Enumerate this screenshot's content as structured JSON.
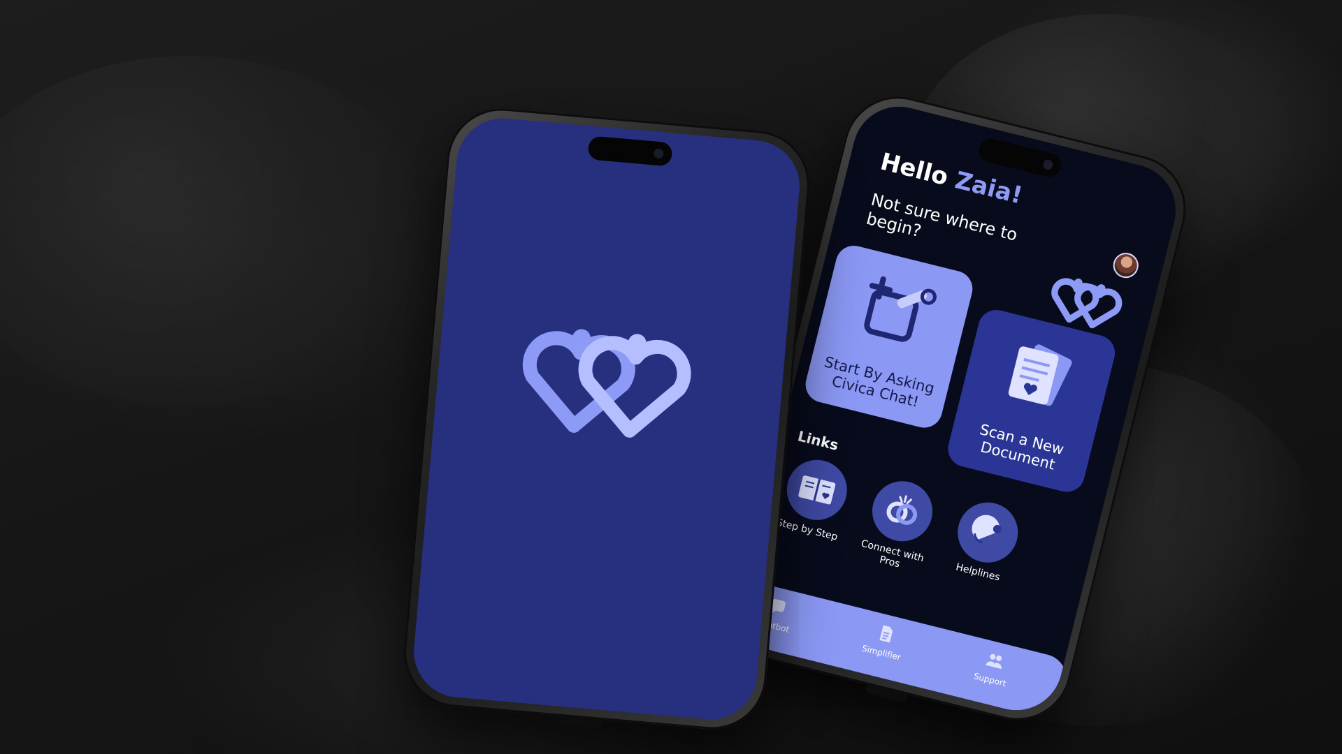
{
  "splash": {
    "logo_icon": "linked-hearts-logo",
    "background": "#26307f",
    "logo_color": "#8e9bf6"
  },
  "home": {
    "greeting_prefix": "Hello",
    "greeting_name": "Zaia!",
    "prompt": "Not sure where to begin?",
    "accent": "#8b98f4",
    "cards": [
      {
        "label": "Start By Asking Civica Chat!",
        "icon": "chat-edit-icon"
      },
      {
        "label": "Scan a New Document",
        "icon": "document-icon"
      }
    ],
    "links_title": "Links",
    "quick_links": [
      {
        "label": "Step by Step",
        "icon": "guide-book-icon"
      },
      {
        "label": "Connect with Pros",
        "icon": "connect-icon"
      },
      {
        "label": "Helplines",
        "icon": "phone-support-icon"
      }
    ],
    "tabs": [
      {
        "label": "Chatbot",
        "icon": "chat-bubble-icon"
      },
      {
        "label": "Simplifier",
        "icon": "document-icon"
      },
      {
        "label": "Support",
        "icon": "people-icon"
      }
    ]
  }
}
